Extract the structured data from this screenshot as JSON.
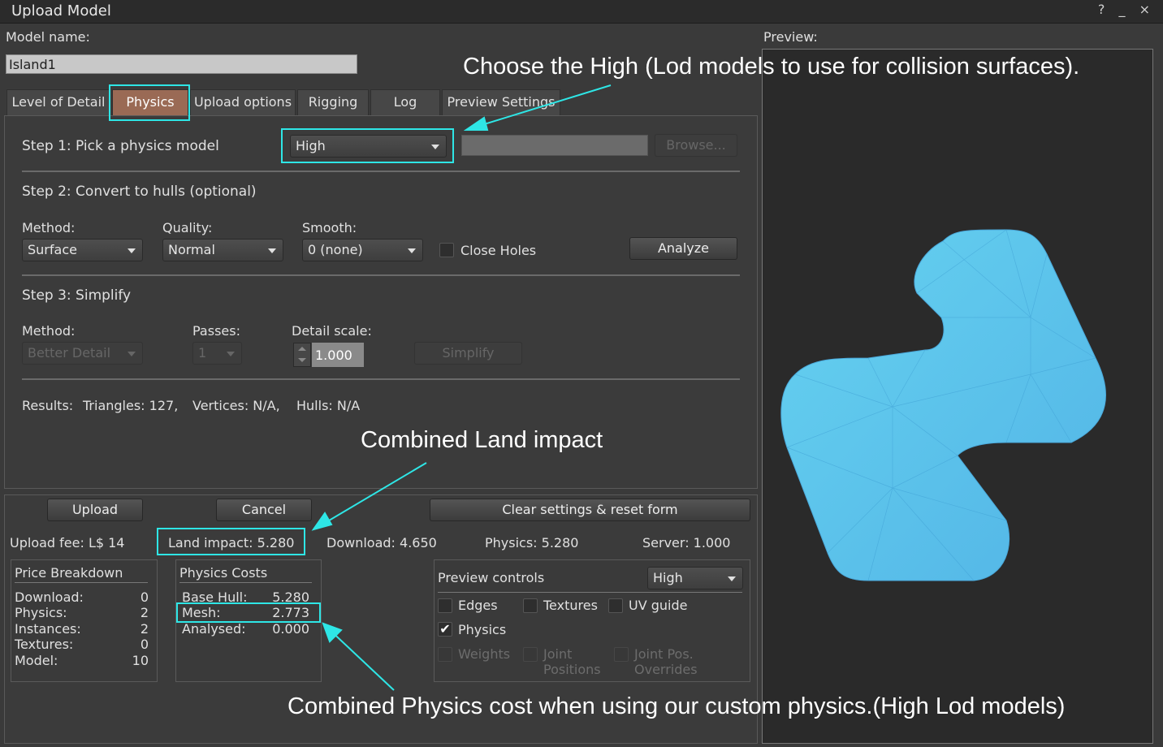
{
  "window": {
    "title": "Upload Model",
    "controls": "? _ ×"
  },
  "model": {
    "label": "Model name:",
    "value": "Island1"
  },
  "preview": {
    "label": "Preview:"
  },
  "tabs": [
    {
      "label": "Level of Detail"
    },
    {
      "label": "Physics"
    },
    {
      "label": "Upload options"
    },
    {
      "label": "Rigging"
    },
    {
      "label": "Log"
    },
    {
      "label": "Preview Settings"
    }
  ],
  "step1": {
    "label": "Step 1: Pick a physics model",
    "selected": "High",
    "browse": "Browse..."
  },
  "step2": {
    "label": "Step 2: Convert to hulls (optional)",
    "method_label": "Method:",
    "method_value": "Surface",
    "quality_label": "Quality:",
    "quality_value": "Normal",
    "smooth_label": "Smooth:",
    "smooth_value": "0 (none)",
    "close_holes": "Close Holes",
    "analyze": "Analyze"
  },
  "step3": {
    "label": "Step 3: Simplify",
    "method_label": "Method:",
    "method_value": "Better Detail",
    "passes_label": "Passes:",
    "passes_value": "1",
    "detail_label": "Detail scale:",
    "detail_value": "1.000",
    "simplify": "Simplify"
  },
  "results": {
    "label": "Results:",
    "triangles": "Triangles: 127,",
    "vertices": "Vertices: N/A,",
    "hulls": "Hulls: N/A"
  },
  "bottom": {
    "upload": "Upload",
    "cancel": "Cancel",
    "clear": "Clear settings & reset form",
    "upload_fee": "Upload fee: L$ 14",
    "land_impact": "Land impact: 5.280",
    "download": "Download: 4.650",
    "physics": "Physics: 5.280",
    "server": "Server: 1.000"
  },
  "price_breakdown": {
    "title": "Price Breakdown",
    "rows": [
      {
        "k": "Download:",
        "v": "0"
      },
      {
        "k": "Physics:",
        "v": "2"
      },
      {
        "k": "Instances:",
        "v": "2"
      },
      {
        "k": "Textures:",
        "v": "0"
      },
      {
        "k": "Model:",
        "v": "10"
      }
    ]
  },
  "physics_costs": {
    "title": "Physics Costs",
    "rows": [
      {
        "k": "Base Hull:",
        "v": "5.280"
      },
      {
        "k": "Mesh:",
        "v": "2.773"
      },
      {
        "k": "Analysed:",
        "v": "0.000"
      }
    ]
  },
  "preview_controls": {
    "title": "Preview controls",
    "lod": "High",
    "edges": "Edges",
    "textures": "Textures",
    "uv_guide": "UV guide",
    "physics": "Physics",
    "physics_checked": "✔",
    "weights": "Weights",
    "joint_positions_1": "Joint",
    "joint_positions_2": "Positions",
    "joint_overrides_1": "Joint Pos.",
    "joint_overrides_2": "Overrides"
  },
  "annotations": {
    "choose_high": "Choose the High (Lod models to use for collision surfaces).",
    "combined_land": "Combined Land impact",
    "combined_physics": "Combined Physics cost when using our custom physics.(High Lod models)"
  },
  "colors": {
    "highlight": "#2ee6e6",
    "active_tab": "#9a6a55",
    "mesh": "#5cc3ea"
  }
}
